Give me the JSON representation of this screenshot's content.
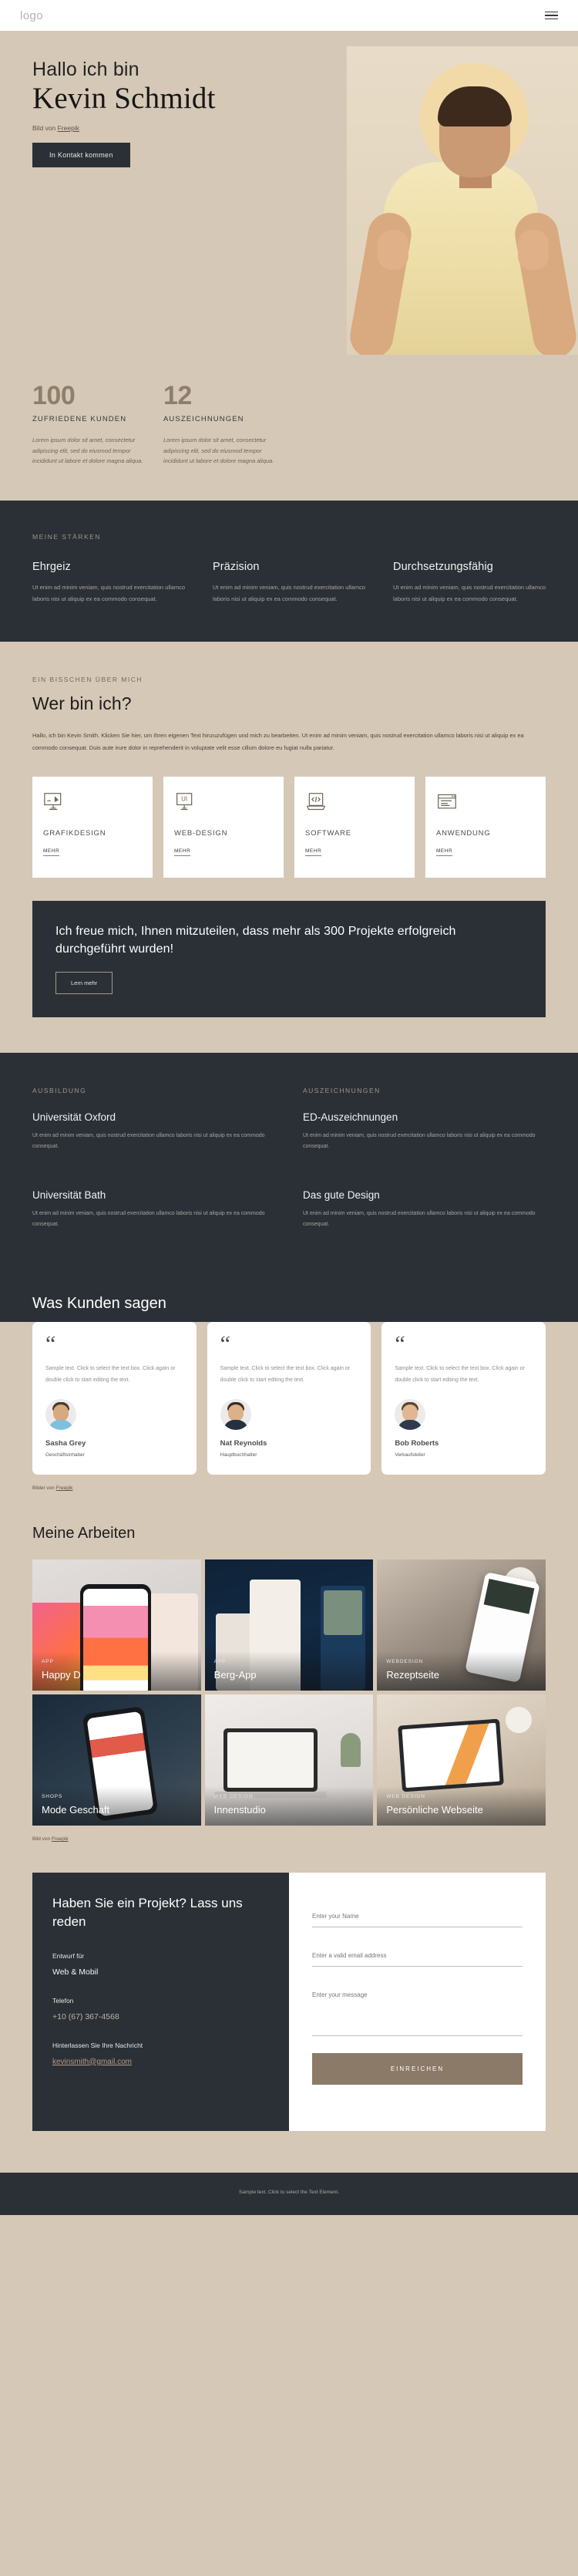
{
  "header": {
    "logo": "logo",
    "menu_icon": "hamburger-menu-icon"
  },
  "hero": {
    "greeting": "Hallo ich bin",
    "name": "Kevin Schmidt",
    "credit_prefix": "Bild von ",
    "credit_link": "Freepik",
    "cta": "In Kontakt kommen"
  },
  "stats": [
    {
      "number": "100",
      "label": "ZUFRIEDENE KUNDEN",
      "text": "Lorem ipsum dolor sit amet, consectetur adipiscing elit, sed do eiusmod tempor incididunt ut labore et dolore magna aliqua."
    },
    {
      "number": "12",
      "label": "AUSZEICHNUNGEN",
      "text": "Lorem ipsum dolor sit amet, consectetur adipiscing elit, sed do eiusmod tempor incididunt ut labore et dolore magna aliqua."
    }
  ],
  "strengths": {
    "eyebrow": "MEINE STÄRKEN",
    "items": [
      {
        "title": "Ehrgeiz",
        "text": "Ut enim ad minim veniam, quis nostrud exercitation ullamco laboris nisi ut aliquip ex ea commodo consequat."
      },
      {
        "title": "Präzision",
        "text": "Ut enim ad minim veniam, quis nostrud exercitation ullamco laboris nisi ut aliquip ex ea commodo consequat."
      },
      {
        "title": "Durchsetzungsfähig",
        "text": "Ut enim ad minim veniam, quis nostrud exercitation ullamco laboris nisi ut aliquip ex ea commodo consequat."
      }
    ]
  },
  "about": {
    "eyebrow": "EIN BISSCHEN ÜBER MICH",
    "title": "Wer bin ich?",
    "lead": "Hallo, ich bin Kevin Smith. Klicken Sie hier, um Ihren eigenen Text hinzuzufügen und mich zu bearbeiten. Ut enim ad minim veniam, quis nostrud exercitation ullamco laboris nisi ut aliquip ex ea commodo consequat. Duis aute irure dolor in reprehenderit in voluptate velit esse cillum dolore eu fugiat nulla pariatur.",
    "cards": [
      {
        "icon": "graphic-design-icon",
        "title": "GRAFIKDESIGN",
        "more": "MEHR"
      },
      {
        "icon": "ui-monitor-icon",
        "title": "WEB-DESIGN",
        "more": "MEHR"
      },
      {
        "icon": "code-laptop-icon",
        "title": "SOFTWARE",
        "more": "MEHR"
      },
      {
        "icon": "window-app-icon",
        "title": "ANWENDUNG",
        "more": "MEHR"
      }
    ]
  },
  "cta_banner": {
    "headline": "Ich freue mich, Ihnen mitzuteilen, dass mehr als 300 Projekte erfolgreich durchgeführt wurden!",
    "button": "Lern mehr"
  },
  "education": {
    "left_eyebrow": "AUSBILDUNG",
    "right_eyebrow": "AUSZEICHNUNGEN",
    "left_items": [
      {
        "title": "Universität Oxford",
        "text": "Ut enim ad minim veniam, quis nostrud exercitation ullamco laboris nisi ut aliquip ex ea commodo consequat."
      },
      {
        "title": "Universität Bath",
        "text": "Ut enim ad minim veniam, quis nostrud exercitation ullamco laboris nisi ut aliquip ex ea commodo consequat."
      }
    ],
    "right_items": [
      {
        "title": "ED-Auszeichnungen",
        "text": "Ut enim ad minim veniam, quis nostrud exercitation ullamco laboris nisi ut aliquip ex ea commodo consequat."
      },
      {
        "title": "Das gute Design",
        "text": "Ut enim ad minim veniam, quis nostrud exercitation ullamco laboris nisi ut aliquip ex ea commodo consequat."
      }
    ]
  },
  "testimonials": {
    "title": "Was Kunden sagen",
    "credit_prefix": "Bilder von ",
    "credit_link": "Freepik",
    "items": [
      {
        "quote_mark": "“",
        "text": "Sample text. Click to select the text box. Click again or double click to start editing the text.",
        "name": "Sasha Grey",
        "role": "Geschäftsinhaber"
      },
      {
        "quote_mark": "“",
        "text": "Sample text. Click to select the text box. Click again or double click to start editing the text.",
        "name": "Nat Reynolds",
        "role": "Hauptbuchhalter"
      },
      {
        "quote_mark": "“",
        "text": "Sample text. Click to select the text box. Click again or double click to start editing the text.",
        "name": "Bob Roberts",
        "role": "Verkaufsleiter"
      }
    ]
  },
  "works": {
    "title": "Meine Arbeiten",
    "credit_prefix": "Bild von ",
    "credit_link": "Freepik",
    "items": [
      {
        "category": "APP",
        "title": "Happy Day-App"
      },
      {
        "category": "APP",
        "title": "Berg-App"
      },
      {
        "category": "WEBDESIGN",
        "title": "Rezeptseite"
      },
      {
        "category": "SHOPS",
        "title": "Mode Geschaft"
      },
      {
        "category": "WEB-DESIGN",
        "title": "Innenstudio"
      },
      {
        "category": "WEB DESIGN",
        "title": "Persönliche Webseite"
      }
    ]
  },
  "contact": {
    "title": "Haben Sie ein Projekt? Lass uns reden",
    "design_for_label": "Entwurf für",
    "design_for_value": "Web & Mobil",
    "phone_label": "Telefon",
    "phone_value": "+10 (67) 367-4568",
    "message_label": "Hinterlassen Sie Ihre Nachricht",
    "email_value": "kevinsmith@gmail.com",
    "form": {
      "name_placeholder": "Enter your Name",
      "email_placeholder": "Enter a valid email address",
      "message_placeholder": "Enter your message",
      "submit_label": "EINREICHEN"
    }
  },
  "footer": {
    "text": "Sample text. Click to select the Text Element."
  },
  "colors": {
    "beige": "#d6c8b6",
    "dark": "#2b3036",
    "accent": "#8b7a68",
    "white": "#ffffff"
  }
}
